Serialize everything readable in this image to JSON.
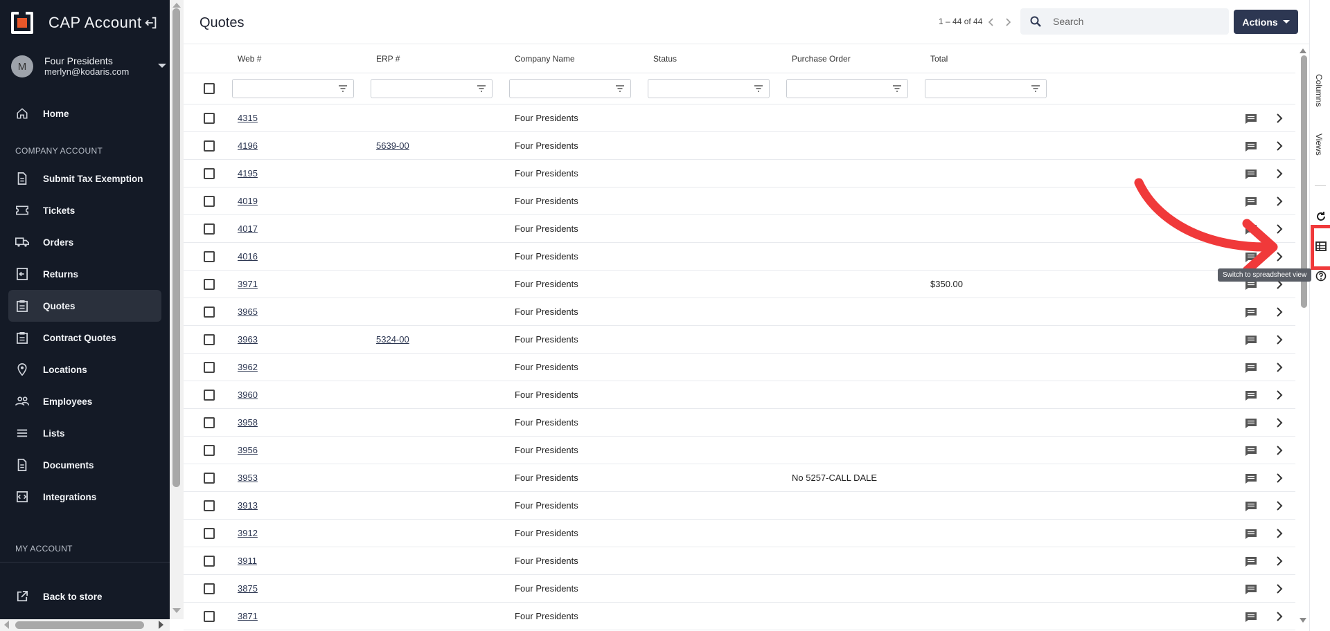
{
  "app": {
    "title": "CAP Account",
    "account_name": "Four Presidents",
    "account_email": "merlyn@kodaris.com",
    "avatar_initial": "M"
  },
  "sidebar": {
    "top_items": [
      {
        "label": "Home",
        "icon": "home-icon"
      }
    ],
    "company_section_label": "COMPANY ACCOUNT",
    "company_items": [
      {
        "label": "Submit Tax Exemption",
        "icon": "document-icon"
      },
      {
        "label": "Tickets",
        "icon": "ticket-icon"
      },
      {
        "label": "Orders",
        "icon": "truck-icon"
      },
      {
        "label": "Returns",
        "icon": "return-icon"
      },
      {
        "label": "Quotes",
        "icon": "clipboard-icon",
        "active": true
      },
      {
        "label": "Contract Quotes",
        "icon": "clipboard-icon"
      },
      {
        "label": "Locations",
        "icon": "pin-icon"
      },
      {
        "label": "Employees",
        "icon": "people-icon"
      },
      {
        "label": "Lists",
        "icon": "list-icon"
      },
      {
        "label": "Documents",
        "icon": "document-icon"
      },
      {
        "label": "Integrations",
        "icon": "integration-icon"
      }
    ],
    "my_account_label": "MY ACCOUNT",
    "back_to_store": "Back to store"
  },
  "header": {
    "title": "Quotes",
    "pager_text": "1 – 44 of 44",
    "search_placeholder": "Search",
    "actions_label": "Actions"
  },
  "table": {
    "columns": [
      "Web #",
      "ERP #",
      "Company Name",
      "Status",
      "Purchase Order",
      "Total"
    ],
    "rows": [
      {
        "web": "4315",
        "erp": "",
        "company": "Four Presidents",
        "status": "",
        "po": "",
        "total": ""
      },
      {
        "web": "4196",
        "erp": "5639-00",
        "company": "Four Presidents",
        "status": "",
        "po": "",
        "total": ""
      },
      {
        "web": "4195",
        "erp": "",
        "company": "Four Presidents",
        "status": "",
        "po": "",
        "total": ""
      },
      {
        "web": "4019",
        "erp": "",
        "company": "Four Presidents",
        "status": "",
        "po": "",
        "total": ""
      },
      {
        "web": "4017",
        "erp": "",
        "company": "Four Presidents",
        "status": "",
        "po": "",
        "total": ""
      },
      {
        "web": "4016",
        "erp": "",
        "company": "Four Presidents",
        "status": "",
        "po": "",
        "total": ""
      },
      {
        "web": "3971",
        "erp": "",
        "company": "Four Presidents",
        "status": "",
        "po": "",
        "total": "$350.00"
      },
      {
        "web": "3965",
        "erp": "",
        "company": "Four Presidents",
        "status": "",
        "po": "",
        "total": ""
      },
      {
        "web": "3963",
        "erp": "5324-00",
        "company": "Four Presidents",
        "status": "",
        "po": "",
        "total": ""
      },
      {
        "web": "3962",
        "erp": "",
        "company": "Four Presidents",
        "status": "",
        "po": "",
        "total": ""
      },
      {
        "web": "3960",
        "erp": "",
        "company": "Four Presidents",
        "status": "",
        "po": "",
        "total": ""
      },
      {
        "web": "3958",
        "erp": "",
        "company": "Four Presidents",
        "status": "",
        "po": "",
        "total": ""
      },
      {
        "web": "3956",
        "erp": "",
        "company": "Four Presidents",
        "status": "",
        "po": "",
        "total": ""
      },
      {
        "web": "3953",
        "erp": "",
        "company": "Four Presidents",
        "status": "",
        "po": "No 5257-CALL DALE",
        "total": ""
      },
      {
        "web": "3913",
        "erp": "",
        "company": "Four Presidents",
        "status": "",
        "po": "",
        "total": ""
      },
      {
        "web": "3912",
        "erp": "",
        "company": "Four Presidents",
        "status": "",
        "po": "",
        "total": ""
      },
      {
        "web": "3911",
        "erp": "",
        "company": "Four Presidents",
        "status": "",
        "po": "",
        "total": ""
      },
      {
        "web": "3875",
        "erp": "",
        "company": "Four Presidents",
        "status": "",
        "po": "",
        "total": ""
      },
      {
        "web": "3871",
        "erp": "",
        "company": "Four Presidents",
        "status": "",
        "po": "",
        "total": ""
      }
    ]
  },
  "side_panel": {
    "columns_label": "Columns",
    "views_label": "Views",
    "tooltip": "Switch to spreadsheet view"
  },
  "colors": {
    "sidebar_bg": "#141a26",
    "accent": "#2d3752",
    "logo_orange": "#e8572a",
    "annotation_red": "#f0393a"
  }
}
